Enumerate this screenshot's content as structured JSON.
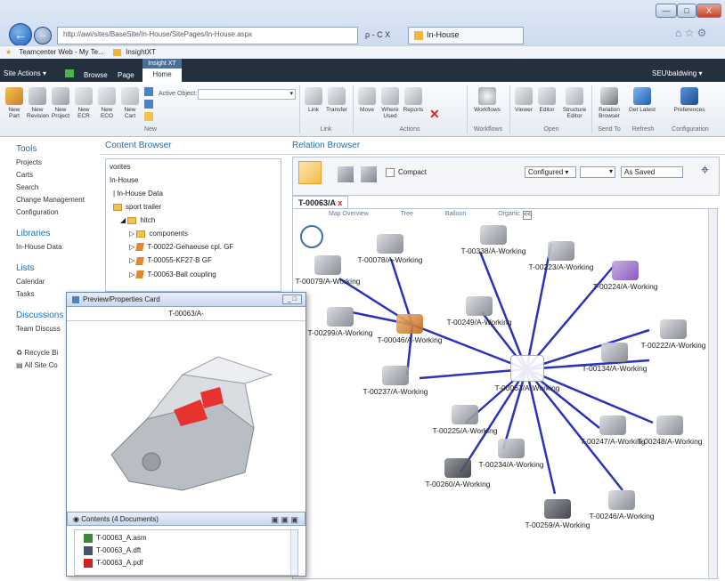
{
  "browser": {
    "address": "http://awi/sites/BaseSite/In-House/SitePages/In-House.aspx",
    "address_controls": "ρ - C X",
    "tab_title": "In-House",
    "fav_items": [
      "Teamcenter Web - My Te...",
      "InsightXT"
    ],
    "win_controls": [
      "—",
      "□",
      "X"
    ]
  },
  "sharepoint": {
    "site_actions": "Site Actions ▾",
    "browse": "Browse",
    "page": "Page",
    "insight_tab_group": "Insight XT",
    "home_tab": "Home",
    "user": "SEU\\baldwing ▾"
  },
  "ribbon": {
    "new_buttons": [
      "New Part",
      "New Revision",
      "New Project",
      "New ECR",
      "New ECO",
      "New Cart"
    ],
    "active_object_label": "Active Object:",
    "link_buttons": [
      "Link",
      "Transfer"
    ],
    "action_buttons": [
      "Move",
      "Where Used",
      "Reports"
    ],
    "workflow_buttons": [
      "Workflows"
    ],
    "open_buttons": [
      "Viewer",
      "Editor",
      "Structure Editor"
    ],
    "sendto_buttons": [
      "Relation Browser"
    ],
    "refresh_buttons": [
      "Get Latest"
    ],
    "config_buttons": [
      "Preferences"
    ],
    "groups": [
      "New",
      "Link",
      "Actions",
      "Workflows",
      "Open",
      "Send To",
      "Refresh",
      "Configuration"
    ]
  },
  "leftnav": {
    "tools_heading": "Tools",
    "tools": [
      "Projects",
      "Carts",
      "Search",
      "Change Management",
      "Configuration"
    ],
    "libraries_heading": "Libraries",
    "libraries": [
      "In-House Data"
    ],
    "lists_heading": "Lists",
    "lists": [
      "Calendar",
      "Tasks"
    ],
    "discussions_heading": "Discussions",
    "discussions": [
      "Team Discuss"
    ],
    "bottom": [
      "Recycle Bi",
      "All Site Co"
    ]
  },
  "content_browser": {
    "title": "Content Browser",
    "tree": [
      "vorites",
      "In-House",
      "In-House Data",
      "sport trailer",
      "hitch",
      "components",
      "T-00022-Gehaeuse cpl. GF",
      "T-00055-KF27-B GF",
      "T-00063-Ball coupling"
    ]
  },
  "relation_browser": {
    "title": "Relation Browser",
    "compact_label": "Compact",
    "configured": "Configured",
    "as_saved": "As Saved",
    "doc_tab": "T-00063/A",
    "view_tabs": [
      "Map Overview",
      "Tree",
      "Balloon",
      "Organic"
    ],
    "nodes": [
      {
        "id": "T-00063/A-Working"
      },
      {
        "id": "T-00079/A-Working"
      },
      {
        "id": "T-00078/A-Working"
      },
      {
        "id": "T-00338/A-Working"
      },
      {
        "id": "T-00223/A-Working"
      },
      {
        "id": "T-00224/A-Working"
      },
      {
        "id": "T-00299/A-Working"
      },
      {
        "id": "T-00046/A-Working"
      },
      {
        "id": "T-00249/A-Working"
      },
      {
        "id": "T-00222/A-Working"
      },
      {
        "id": "T-00134/A-Working"
      },
      {
        "id": "T-00237/A-Working"
      },
      {
        "id": "T-00225/A-Working"
      },
      {
        "id": "T-00247/A-Working"
      },
      {
        "id": "T-00248/A-Working"
      },
      {
        "id": "T-00234/A-Working"
      },
      {
        "id": "T-00260/A-Working"
      },
      {
        "id": "T-00259/A-Working"
      },
      {
        "id": "T-00246/A-Working"
      }
    ]
  },
  "preview": {
    "title": "Preview/Properties Card",
    "item": "T-00063/A-",
    "contents_label": "Contents (4 Documents)",
    "documents": [
      "T-00063_A.asm",
      "T-00063_A.dft",
      "T-00063_A.pdf"
    ]
  },
  "colors": {
    "accent": "#1c6fb0",
    "edge": "#2b33b8",
    "sp_bar": "#23313f"
  }
}
